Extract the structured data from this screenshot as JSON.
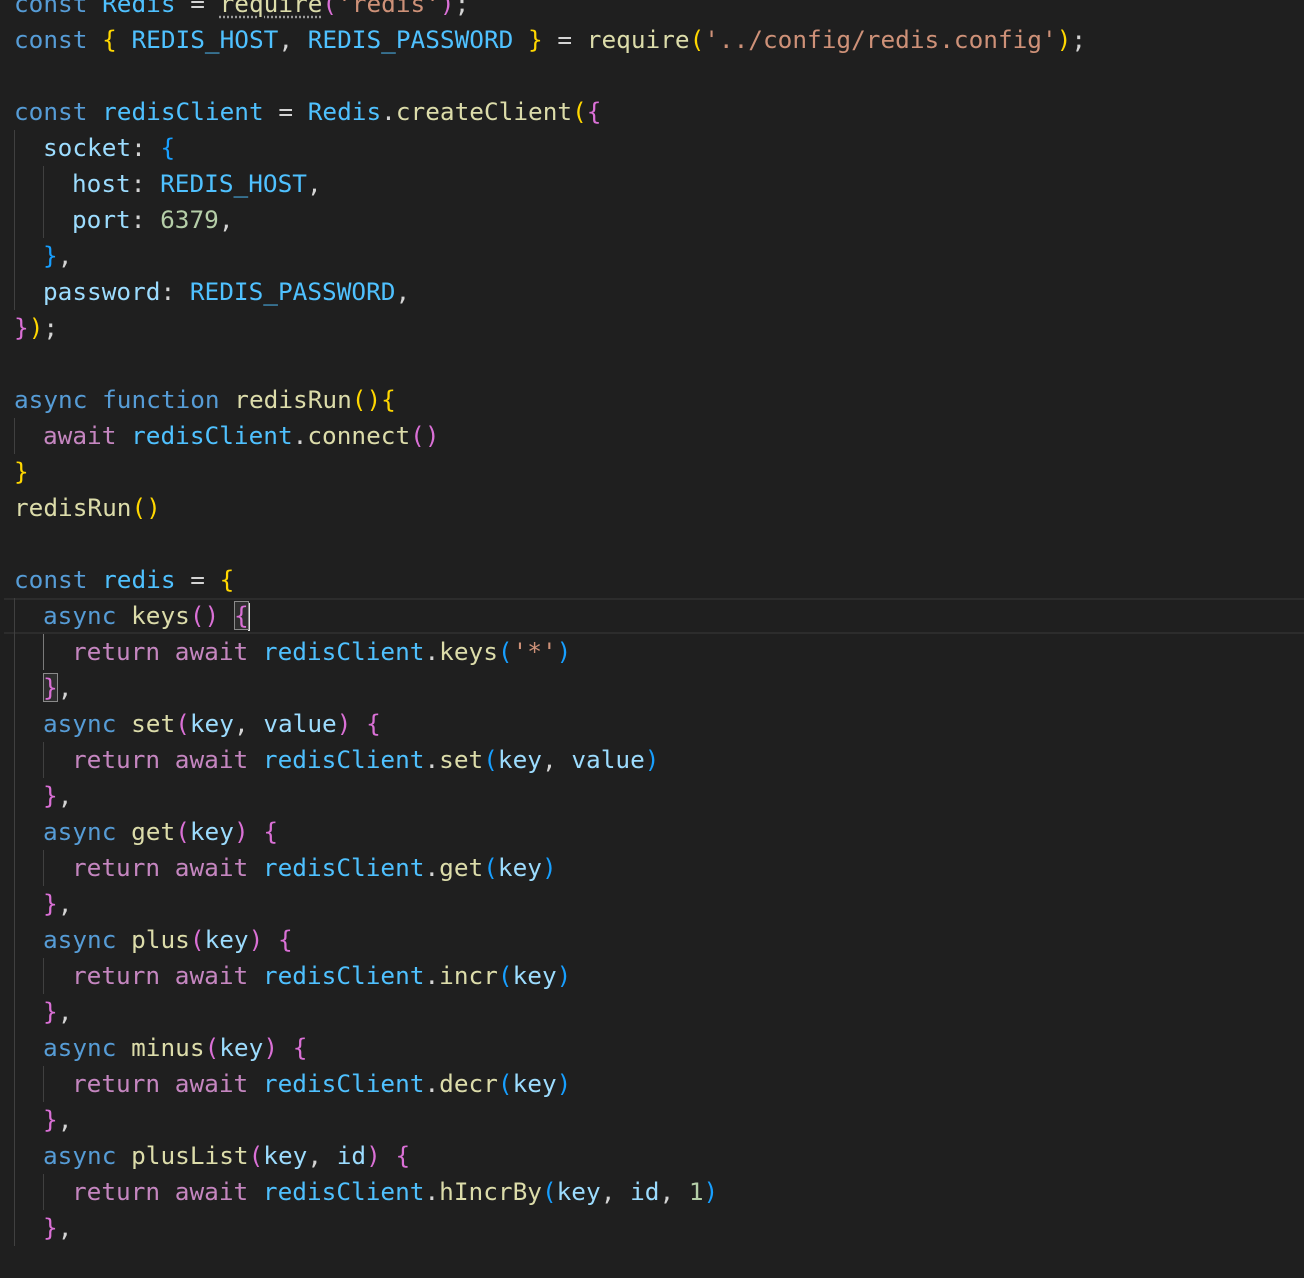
{
  "theme": {
    "background": "#1f1f1f",
    "keyword": "#569cd6",
    "control_keyword": "#c586c0",
    "variable": "#9cdcfe",
    "constant": "#4fc1ff",
    "function": "#dcdcaa",
    "string": "#ce9178",
    "number": "#b5cea8",
    "plain": "#d4d4d4",
    "bracket_gold": "#ffd700",
    "bracket_pink": "#da70d6",
    "bracket_blue": "#179fff"
  },
  "cursor_line": 17,
  "lines": [
    {
      "indent": 0,
      "tokens": [
        {
          "t": "const",
          "c": "keyword"
        },
        {
          "t": " ",
          "c": "plain"
        },
        {
          "t": "Redis",
          "c": "constant"
        },
        {
          "t": " = ",
          "c": "plain"
        },
        {
          "t": "require",
          "c": "function",
          "squiggle": true
        },
        {
          "t": "(",
          "c": "bracket_pink"
        },
        {
          "t": "'redis'",
          "c": "string"
        },
        {
          "t": ")",
          "c": "bracket_pink"
        },
        {
          "t": ";",
          "c": "plain"
        }
      ]
    },
    {
      "indent": 0,
      "tokens": [
        {
          "t": "const",
          "c": "keyword"
        },
        {
          "t": " ",
          "c": "plain"
        },
        {
          "t": "{",
          "c": "bracket_gold"
        },
        {
          "t": " ",
          "c": "plain"
        },
        {
          "t": "REDIS_HOST",
          "c": "constant"
        },
        {
          "t": ", ",
          "c": "plain"
        },
        {
          "t": "REDIS_PASSWORD",
          "c": "constant"
        },
        {
          "t": " ",
          "c": "plain"
        },
        {
          "t": "}",
          "c": "bracket_gold"
        },
        {
          "t": " = ",
          "c": "plain"
        },
        {
          "t": "require",
          "c": "function"
        },
        {
          "t": "(",
          "c": "bracket_gold"
        },
        {
          "t": "'../config/redis.config'",
          "c": "string"
        },
        {
          "t": ")",
          "c": "bracket_gold"
        },
        {
          "t": ";",
          "c": "plain"
        }
      ]
    },
    {
      "indent": 0,
      "tokens": []
    },
    {
      "indent": 0,
      "tokens": [
        {
          "t": "const",
          "c": "keyword"
        },
        {
          "t": " ",
          "c": "plain"
        },
        {
          "t": "redisClient",
          "c": "constant"
        },
        {
          "t": " = ",
          "c": "plain"
        },
        {
          "t": "Redis",
          "c": "constant"
        },
        {
          "t": ".",
          "c": "plain"
        },
        {
          "t": "createClient",
          "c": "function"
        },
        {
          "t": "(",
          "c": "bracket_gold"
        },
        {
          "t": "{",
          "c": "bracket_pink"
        }
      ]
    },
    {
      "indent": 1,
      "tokens": [
        {
          "t": "socket",
          "c": "variable"
        },
        {
          "t": ": ",
          "c": "plain"
        },
        {
          "t": "{",
          "c": "bracket_blue"
        }
      ]
    },
    {
      "indent": 2,
      "tokens": [
        {
          "t": "host",
          "c": "variable"
        },
        {
          "t": ": ",
          "c": "plain"
        },
        {
          "t": "REDIS_HOST",
          "c": "constant"
        },
        {
          "t": ",",
          "c": "plain"
        }
      ]
    },
    {
      "indent": 2,
      "tokens": [
        {
          "t": "port",
          "c": "variable"
        },
        {
          "t": ": ",
          "c": "plain"
        },
        {
          "t": "6379",
          "c": "number"
        },
        {
          "t": ",",
          "c": "plain"
        }
      ]
    },
    {
      "indent": 1,
      "tokens": [
        {
          "t": "}",
          "c": "bracket_blue"
        },
        {
          "t": ",",
          "c": "plain"
        }
      ]
    },
    {
      "indent": 1,
      "tokens": [
        {
          "t": "password",
          "c": "variable"
        },
        {
          "t": ": ",
          "c": "plain"
        },
        {
          "t": "REDIS_PASSWORD",
          "c": "constant"
        },
        {
          "t": ",",
          "c": "plain"
        }
      ]
    },
    {
      "indent": 0,
      "tokens": [
        {
          "t": "}",
          "c": "bracket_pink"
        },
        {
          "t": ")",
          "c": "bracket_gold"
        },
        {
          "t": ";",
          "c": "plain"
        }
      ]
    },
    {
      "indent": 0,
      "tokens": []
    },
    {
      "indent": 0,
      "tokens": [
        {
          "t": "async",
          "c": "keyword"
        },
        {
          "t": " ",
          "c": "plain"
        },
        {
          "t": "function",
          "c": "keyword"
        },
        {
          "t": " ",
          "c": "plain"
        },
        {
          "t": "redisRun",
          "c": "function"
        },
        {
          "t": "()",
          "c": "bracket_gold"
        },
        {
          "t": "{",
          "c": "bracket_gold"
        }
      ]
    },
    {
      "indent": 1,
      "tokens": [
        {
          "t": "await",
          "c": "control_keyword"
        },
        {
          "t": " ",
          "c": "plain"
        },
        {
          "t": "redisClient",
          "c": "constant"
        },
        {
          "t": ".",
          "c": "plain"
        },
        {
          "t": "connect",
          "c": "function"
        },
        {
          "t": "()",
          "c": "bracket_pink"
        }
      ]
    },
    {
      "indent": 0,
      "tokens": [
        {
          "t": "}",
          "c": "bracket_gold"
        }
      ]
    },
    {
      "indent": 0,
      "tokens": [
        {
          "t": "redisRun",
          "c": "function"
        },
        {
          "t": "()",
          "c": "bracket_gold"
        }
      ]
    },
    {
      "indent": 0,
      "tokens": []
    },
    {
      "indent": 0,
      "tokens": [
        {
          "t": "const",
          "c": "keyword"
        },
        {
          "t": " ",
          "c": "plain"
        },
        {
          "t": "redis",
          "c": "constant"
        },
        {
          "t": " = ",
          "c": "plain"
        },
        {
          "t": "{",
          "c": "bracket_gold"
        }
      ]
    },
    {
      "indent": 1,
      "tokens": [
        {
          "t": "async",
          "c": "keyword"
        },
        {
          "t": " ",
          "c": "plain"
        },
        {
          "t": "keys",
          "c": "function"
        },
        {
          "t": "()",
          "c": "bracket_pink"
        },
        {
          "t": " ",
          "c": "plain"
        },
        {
          "t": "{",
          "c": "bracket_pink",
          "match": true,
          "cursor_after": true
        }
      ]
    },
    {
      "indent": 2,
      "tokens": [
        {
          "t": "return",
          "c": "control_keyword"
        },
        {
          "t": " ",
          "c": "plain"
        },
        {
          "t": "await",
          "c": "control_keyword"
        },
        {
          "t": " ",
          "c": "plain"
        },
        {
          "t": "redisClient",
          "c": "constant"
        },
        {
          "t": ".",
          "c": "plain"
        },
        {
          "t": "keys",
          "c": "function"
        },
        {
          "t": "(",
          "c": "bracket_blue"
        },
        {
          "t": "'*'",
          "c": "string"
        },
        {
          "t": ")",
          "c": "bracket_blue"
        }
      ]
    },
    {
      "indent": 1,
      "tokens": [
        {
          "t": "}",
          "c": "bracket_pink",
          "match": true
        },
        {
          "t": ",",
          "c": "plain"
        }
      ]
    },
    {
      "indent": 1,
      "tokens": [
        {
          "t": "async",
          "c": "keyword"
        },
        {
          "t": " ",
          "c": "plain"
        },
        {
          "t": "set",
          "c": "function"
        },
        {
          "t": "(",
          "c": "bracket_pink"
        },
        {
          "t": "key",
          "c": "variable"
        },
        {
          "t": ", ",
          "c": "plain"
        },
        {
          "t": "value",
          "c": "variable"
        },
        {
          "t": ")",
          "c": "bracket_pink"
        },
        {
          "t": " ",
          "c": "plain"
        },
        {
          "t": "{",
          "c": "bracket_pink"
        }
      ]
    },
    {
      "indent": 2,
      "tokens": [
        {
          "t": "return",
          "c": "control_keyword"
        },
        {
          "t": " ",
          "c": "plain"
        },
        {
          "t": "await",
          "c": "control_keyword"
        },
        {
          "t": " ",
          "c": "plain"
        },
        {
          "t": "redisClient",
          "c": "constant"
        },
        {
          "t": ".",
          "c": "plain"
        },
        {
          "t": "set",
          "c": "function"
        },
        {
          "t": "(",
          "c": "bracket_blue"
        },
        {
          "t": "key",
          "c": "variable"
        },
        {
          "t": ", ",
          "c": "plain"
        },
        {
          "t": "value",
          "c": "variable"
        },
        {
          "t": ")",
          "c": "bracket_blue"
        }
      ]
    },
    {
      "indent": 1,
      "tokens": [
        {
          "t": "}",
          "c": "bracket_pink"
        },
        {
          "t": ",",
          "c": "plain"
        }
      ]
    },
    {
      "indent": 1,
      "tokens": [
        {
          "t": "async",
          "c": "keyword"
        },
        {
          "t": " ",
          "c": "plain"
        },
        {
          "t": "get",
          "c": "function"
        },
        {
          "t": "(",
          "c": "bracket_pink"
        },
        {
          "t": "key",
          "c": "variable"
        },
        {
          "t": ")",
          "c": "bracket_pink"
        },
        {
          "t": " ",
          "c": "plain"
        },
        {
          "t": "{",
          "c": "bracket_pink"
        }
      ]
    },
    {
      "indent": 2,
      "tokens": [
        {
          "t": "return",
          "c": "control_keyword"
        },
        {
          "t": " ",
          "c": "plain"
        },
        {
          "t": "await",
          "c": "control_keyword"
        },
        {
          "t": " ",
          "c": "plain"
        },
        {
          "t": "redisClient",
          "c": "constant"
        },
        {
          "t": ".",
          "c": "plain"
        },
        {
          "t": "get",
          "c": "function"
        },
        {
          "t": "(",
          "c": "bracket_blue"
        },
        {
          "t": "key",
          "c": "variable"
        },
        {
          "t": ")",
          "c": "bracket_blue"
        }
      ]
    },
    {
      "indent": 1,
      "tokens": [
        {
          "t": "}",
          "c": "bracket_pink"
        },
        {
          "t": ",",
          "c": "plain"
        }
      ]
    },
    {
      "indent": 1,
      "tokens": [
        {
          "t": "async",
          "c": "keyword"
        },
        {
          "t": " ",
          "c": "plain"
        },
        {
          "t": "plus",
          "c": "function"
        },
        {
          "t": "(",
          "c": "bracket_pink"
        },
        {
          "t": "key",
          "c": "variable"
        },
        {
          "t": ")",
          "c": "bracket_pink"
        },
        {
          "t": " ",
          "c": "plain"
        },
        {
          "t": "{",
          "c": "bracket_pink"
        }
      ]
    },
    {
      "indent": 2,
      "tokens": [
        {
          "t": "return",
          "c": "control_keyword"
        },
        {
          "t": " ",
          "c": "plain"
        },
        {
          "t": "await",
          "c": "control_keyword"
        },
        {
          "t": " ",
          "c": "plain"
        },
        {
          "t": "redisClient",
          "c": "constant"
        },
        {
          "t": ".",
          "c": "plain"
        },
        {
          "t": "incr",
          "c": "function"
        },
        {
          "t": "(",
          "c": "bracket_blue"
        },
        {
          "t": "key",
          "c": "variable"
        },
        {
          "t": ")",
          "c": "bracket_blue"
        }
      ]
    },
    {
      "indent": 1,
      "tokens": [
        {
          "t": "}",
          "c": "bracket_pink"
        },
        {
          "t": ",",
          "c": "plain"
        }
      ]
    },
    {
      "indent": 1,
      "tokens": [
        {
          "t": "async",
          "c": "keyword"
        },
        {
          "t": " ",
          "c": "plain"
        },
        {
          "t": "minus",
          "c": "function"
        },
        {
          "t": "(",
          "c": "bracket_pink"
        },
        {
          "t": "key",
          "c": "variable"
        },
        {
          "t": ")",
          "c": "bracket_pink"
        },
        {
          "t": " ",
          "c": "plain"
        },
        {
          "t": "{",
          "c": "bracket_pink"
        }
      ]
    },
    {
      "indent": 2,
      "tokens": [
        {
          "t": "return",
          "c": "control_keyword"
        },
        {
          "t": " ",
          "c": "plain"
        },
        {
          "t": "await",
          "c": "control_keyword"
        },
        {
          "t": " ",
          "c": "plain"
        },
        {
          "t": "redisClient",
          "c": "constant"
        },
        {
          "t": ".",
          "c": "plain"
        },
        {
          "t": "decr",
          "c": "function"
        },
        {
          "t": "(",
          "c": "bracket_blue"
        },
        {
          "t": "key",
          "c": "variable"
        },
        {
          "t": ")",
          "c": "bracket_blue"
        }
      ]
    },
    {
      "indent": 1,
      "tokens": [
        {
          "t": "}",
          "c": "bracket_pink"
        },
        {
          "t": ",",
          "c": "plain"
        }
      ]
    },
    {
      "indent": 1,
      "tokens": [
        {
          "t": "async",
          "c": "keyword"
        },
        {
          "t": " ",
          "c": "plain"
        },
        {
          "t": "plusList",
          "c": "function"
        },
        {
          "t": "(",
          "c": "bracket_pink"
        },
        {
          "t": "key",
          "c": "variable"
        },
        {
          "t": ", ",
          "c": "plain"
        },
        {
          "t": "id",
          "c": "variable"
        },
        {
          "t": ")",
          "c": "bracket_pink"
        },
        {
          "t": " ",
          "c": "plain"
        },
        {
          "t": "{",
          "c": "bracket_pink"
        }
      ]
    },
    {
      "indent": 2,
      "tokens": [
        {
          "t": "return",
          "c": "control_keyword"
        },
        {
          "t": " ",
          "c": "plain"
        },
        {
          "t": "await",
          "c": "control_keyword"
        },
        {
          "t": " ",
          "c": "plain"
        },
        {
          "t": "redisClient",
          "c": "constant"
        },
        {
          "t": ".",
          "c": "plain"
        },
        {
          "t": "hIncrBy",
          "c": "function"
        },
        {
          "t": "(",
          "c": "bracket_blue"
        },
        {
          "t": "key",
          "c": "variable"
        },
        {
          "t": ", ",
          "c": "plain"
        },
        {
          "t": "id",
          "c": "variable"
        },
        {
          "t": ", ",
          "c": "plain"
        },
        {
          "t": "1",
          "c": "number"
        },
        {
          "t": ")",
          "c": "bracket_blue"
        }
      ]
    },
    {
      "indent": 1,
      "tokens": [
        {
          "t": "}",
          "c": "bracket_pink"
        },
        {
          "t": ",",
          "c": "plain"
        }
      ]
    }
  ]
}
